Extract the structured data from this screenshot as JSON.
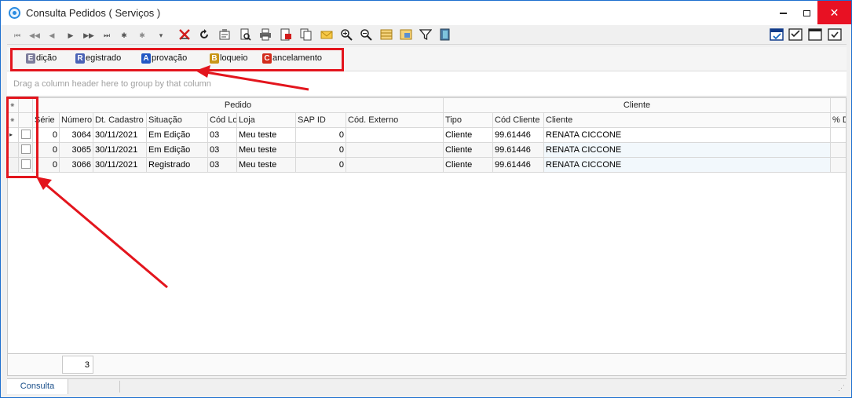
{
  "window": {
    "title": "Consulta Pedidos ( Serviços )",
    "close_glyph": "✕"
  },
  "toolbar": {
    "nav_glyphs": [
      "⏮",
      "◀◀",
      "◀",
      "▶",
      "▶▶",
      "⏭",
      "✱",
      "✱",
      "▾"
    ],
    "icons": [
      "delete-cross-icon",
      "refresh-icon",
      "properties-icon",
      "preview-icon",
      "print-icon",
      "export-pdf-icon",
      "copy-icon",
      "email-icon",
      "zoom-in-icon",
      "zoom-out-icon",
      "layout-icon",
      "grid-settings-icon",
      "filter-icon",
      "exit-icon"
    ],
    "right_icons": [
      "check-window-icon",
      "check-list-icon",
      "blank-window-icon",
      "checkbox-icon"
    ]
  },
  "legend": {
    "items": [
      {
        "letter": "E",
        "rest": "dição",
        "color": "#7d7d9c"
      },
      {
        "letter": "R",
        "rest": "egistrado",
        "color": "#4b63b6"
      },
      {
        "letter": "A",
        "rest": "provação",
        "color": "#2257c4"
      },
      {
        "letter": "B",
        "rest": "loqueio",
        "color": "#c99618"
      },
      {
        "letter": "C",
        "rest": "ancelamento",
        "color": "#d22c1c"
      }
    ]
  },
  "group_panel": {
    "text": "Drag a column header here to group by that column"
  },
  "grid": {
    "band_pedido": "Pedido",
    "band_cliente": "Cliente",
    "indicator_glyph": "⁕",
    "current_row_glyph": "▸",
    "columns": [
      "Série",
      "Número",
      "Dt. Cadastro",
      "Situação",
      "Cód Lo",
      "Loja",
      "SAP ID",
      "Cód. Externo",
      "Tipo",
      "Cód Cliente",
      "Cliente",
      "% D"
    ],
    "rows": [
      {
        "serie": "0",
        "numero": "3064",
        "dt": "30/11/2021",
        "situacao": "Em Edição",
        "codlo": "03",
        "loja": "Meu teste",
        "sap": "0",
        "externo": "",
        "tipo": "Cliente",
        "codcli": "99.61446",
        "cliente": "RENATA CICCONE"
      },
      {
        "serie": "0",
        "numero": "3065",
        "dt": "30/11/2021",
        "situacao": "Em Edição",
        "codlo": "03",
        "loja": "Meu teste",
        "sap": "0",
        "externo": "",
        "tipo": "Cliente",
        "codcli": "99.61446",
        "cliente": "RENATA CICCONE"
      },
      {
        "serie": "0",
        "numero": "3066",
        "dt": "30/11/2021",
        "situacao": "Registrado",
        "codlo": "03",
        "loja": "Meu teste",
        "sap": "0",
        "externo": "",
        "tipo": "Cliente",
        "codcli": "99.61446",
        "cliente": "RENATA CICCONE"
      }
    ]
  },
  "footer": {
    "record_count": "3"
  },
  "tabs": [
    {
      "label": "Consulta"
    }
  ],
  "colors": {
    "annotation_red": "#e3151d",
    "window_border": "#1d6fcf",
    "close_button": "#e81123"
  }
}
